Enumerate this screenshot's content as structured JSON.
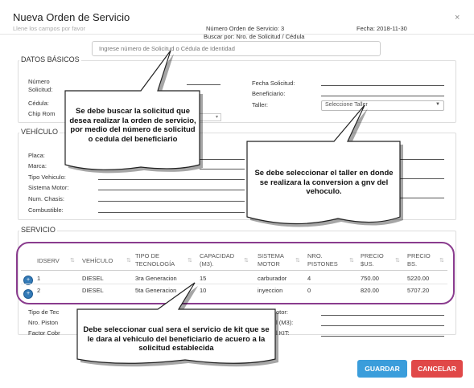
{
  "modal": {
    "title": "Nueva Orden de Servicio",
    "subtitle": "Llene los campos por favor",
    "close": "×",
    "order_number": "Número Orden de Servicio: 3",
    "date": "Fecha: 2018-11-30",
    "search_by": "Buscar por: Nro. de Solicitud / Cédula",
    "search_placeholder": "Ingrese número de Solicitud o Cédula de Identidad"
  },
  "datos_basicos": {
    "legend": "DATOS BÁSICOS",
    "numero_solicitud_1": "Número",
    "numero_solicitud_2": "Solicitud:",
    "cedula": "Cédula:",
    "chip": "Chip Rom",
    "fecha_solicitud": "Fecha Solicitud:",
    "beneficiario": "Beneficiario:",
    "taller": "Taller:",
    "taller_select": "Seleccione Taller"
  },
  "vehiculo": {
    "legend": "VEHÍCULO",
    "placa": "Placa:",
    "marca": "Marca:",
    "tipo_vehiculo": "Tipo Vehiculo:",
    "sistema_motor": "Sistema Motor:",
    "num_chasis": "Num. Chasis:",
    "combustible": "Combustible:"
  },
  "servicio": {
    "legend": "SERVICIO",
    "columns": {
      "idserv": "IDSERV",
      "vehiculo": "VEHÍCULO",
      "tipo_tec_1": "TIPO DE",
      "tipo_tec_2": "TECNOLOGÍA",
      "capacidad_1": "CAPACIDAD",
      "capacidad_2": "(M3).",
      "sistema_1": "SISTEMA",
      "sistema_2": "MOTOR",
      "pistones_1": "NRO.",
      "pistones_2": "PISTONES",
      "precio_usd_1": "PRECIO",
      "precio_usd_2": "$US.",
      "precio_bs_1": "PRECIO",
      "precio_bs_2": "BS."
    },
    "rows": [
      {
        "id": "1",
        "vehiculo": "DIESEL",
        "tecnologia": "3ra Generacion",
        "capacidad": "15",
        "sistema": "carburador",
        "pistones": "4",
        "precio_usd": "750.00",
        "precio_bs": "5220.00"
      },
      {
        "id": "2",
        "vehiculo": "DIESEL",
        "tecnologia": "5ta Generacion",
        "capacidad": "10",
        "sistema": "inyeccion",
        "pistones": "0",
        "precio_usd": "820.00",
        "precio_bs": "5707.20"
      }
    ],
    "bottom_labels": {
      "tipo_tec": "Tipo de Tec",
      "nro_piston": "Nro. Piston",
      "factor_cobr": "Factor Cobr",
      "motor": "otor:",
      "m3": "l (M3):",
      "kit": "l KIT:"
    }
  },
  "callouts": {
    "search": "Se debe buscar la solicitud que desea realizar la orden de servicio, por medio del número de solicitud o cedula del beneficiario",
    "taller": "Se debe seleccionar el taller en donde se realizara la conversion a gnv del vehoculo.",
    "kit": "Debe seleccionar cual sera el servicio de kit que se le dara al vehiculo del beneficiario de acuero a la solicitud establecida"
  },
  "buttons": {
    "save": "GUARDAR",
    "cancel": "CANCELAR"
  },
  "colors": {
    "save": "#3a9ddb",
    "cancel": "#e04848",
    "highlight": "#8a3c8e",
    "expand": "#337ab7"
  }
}
